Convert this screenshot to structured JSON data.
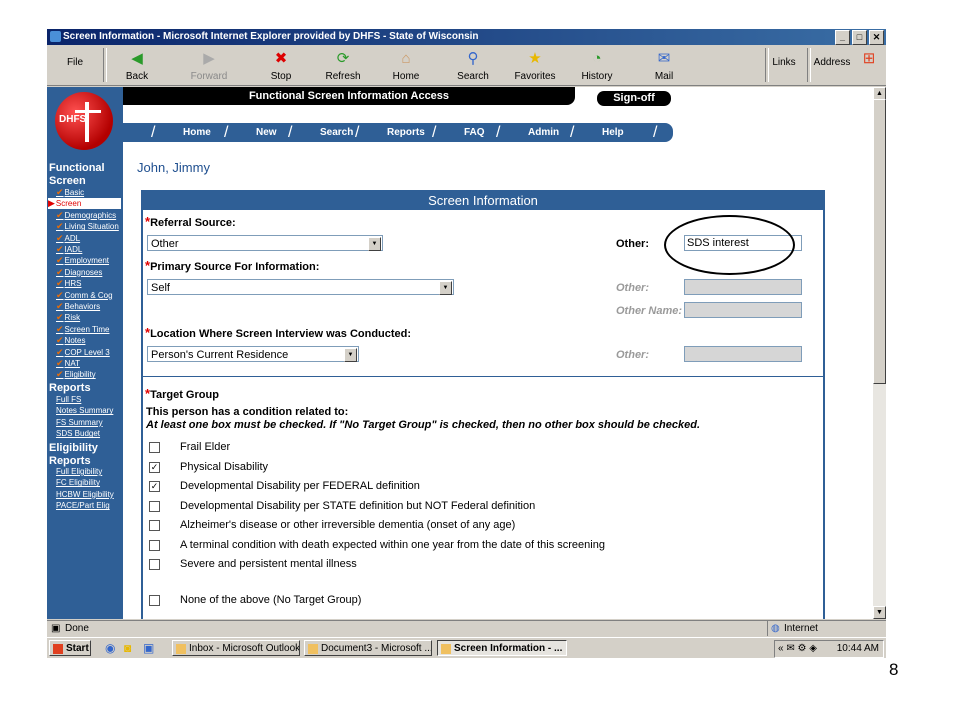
{
  "window": {
    "title": "Screen Information - Microsoft Internet Explorer provided by DHFS - State of Wisconsin",
    "btn_min": "_",
    "btn_max": "□",
    "btn_close": "✕"
  },
  "toolbar": {
    "file": "File",
    "back": "Back",
    "forward": "Forward",
    "stop": "Stop",
    "refresh": "Refresh",
    "home": "Home",
    "search": "Search",
    "favorites": "Favorites",
    "history": "History",
    "mail": "Mail",
    "links": "Links",
    "address": "Address"
  },
  "site": {
    "logo": "DHFS",
    "header": "Functional Screen Information Access",
    "signoff": "Sign-off",
    "nav": [
      "Home",
      "New",
      "Search",
      "Reports",
      "FAQ",
      "Admin",
      "Help"
    ]
  },
  "sidebar": {
    "sec_functional": "Functional Screen",
    "items": [
      "Basic",
      "Screen",
      "Demographics",
      "Living Situation",
      "ADL",
      "IADL",
      "Employment",
      "Diagnoses",
      "HRS",
      "Comm & Cog",
      "Behaviors",
      "Risk",
      "Screen Time",
      "Notes",
      "COP Level 3",
      "NAT",
      "Eligibility"
    ],
    "sec_reports": "Reports",
    "reports": [
      "Full FS",
      "Notes Summary",
      "FS Summary",
      "SDS Budget"
    ],
    "sec_elig": "Eligibility Reports",
    "elig": [
      "Full Eligibility",
      "FC Eligibility",
      "HCBW Eligibility",
      "PACE/Part Elig"
    ]
  },
  "patient_name": "John, Jimmy",
  "panel": {
    "title": "Screen Information",
    "referral_label": "Referral Source:",
    "referral_value": "Other",
    "other_label": "Other:",
    "other_value": "SDS interest",
    "primary_label": "Primary Source For Information:",
    "primary_value": "Self",
    "other2_label": "Other:",
    "othername_label": "Other Name:",
    "location_label": "Location Where Screen Interview was Conducted:",
    "location_value": "Person's Current Residence",
    "other3_label": "Other:",
    "target_label": "Target Group",
    "target_desc": "This person has a condition related to:",
    "target_note": "At least one box must be checked. If \"No Target Group\" is checked, then no other box should be checked.",
    "targets": [
      {
        "label": "Frail Elder",
        "checked": false
      },
      {
        "label": "Physical Disability",
        "checked": true
      },
      {
        "label": "Developmental Disability per FEDERAL definition",
        "checked": true
      },
      {
        "label": "Developmental Disability per STATE definition but NOT Federal definition",
        "checked": false
      },
      {
        "label": "Alzheimer's disease or other irreversible dementia (onset of any age)",
        "checked": false
      },
      {
        "label": "A terminal condition with death expected within one year from the date of this screening",
        "checked": false
      },
      {
        "label": "Severe and persistent mental illness",
        "checked": false
      },
      {
        "label": "None of the above (No Target Group)",
        "checked": false
      }
    ],
    "check_glyph": "✓"
  },
  "status": {
    "left": "Done",
    "zone": "Internet"
  },
  "taskbar": {
    "start": "Start",
    "tasks": [
      "Inbox - Microsoft Outlook",
      "Document3 - Microsoft ...",
      "Screen Information - ..."
    ],
    "time": "10:44 AM"
  },
  "page_number": "8"
}
